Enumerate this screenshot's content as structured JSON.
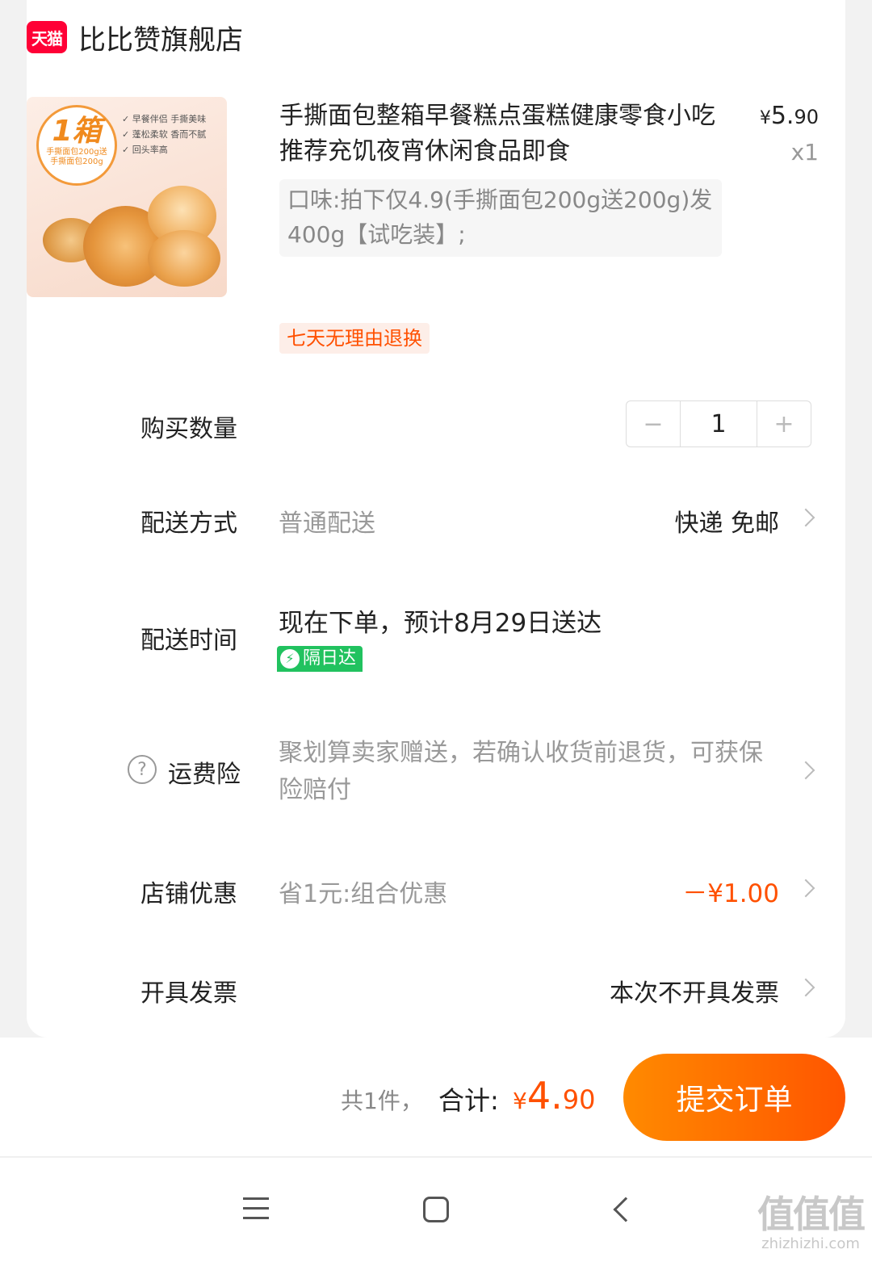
{
  "shop": {
    "logo_text": "天猫",
    "name": "比比赞旗舰店"
  },
  "product": {
    "image_badge_big": "1箱",
    "image_badge_small_1": "手撕面包200g送",
    "image_badge_small_2": "手撕面包200g",
    "image_notes": [
      "早餐伴侣 手撕美味",
      "蓬松柔软 香而不腻",
      "回头率高"
    ],
    "title": "手撕面包整箱早餐糕点蛋糕健康零食小吃推荐充饥夜宵休闲食品即食",
    "price_symbol": "¥",
    "price_int": "5.",
    "price_cents": "90",
    "quantity": "x1",
    "spec": "口味:拍下仅4.9(手撕面包200g送200g)发400g【试吃装】;",
    "return_tag": "七天无理由退换"
  },
  "quantity_row": {
    "label": "购买数量",
    "minus": "−",
    "value": "1",
    "plus": "+"
  },
  "delivery_method": {
    "label": "配送方式",
    "value": "普通配送",
    "right": "快递 免邮"
  },
  "delivery_time": {
    "label": "配送时间",
    "eta": "现在下单，预计8月29日送达",
    "tag_icon": "⚡",
    "tag": "隔日达"
  },
  "shipping_insurance": {
    "label": "运费险",
    "help_icon": "?",
    "text": "聚划算卖家赠送，若确认收货前退货，可获保险赔付"
  },
  "shop_discount": {
    "label": "店铺优惠",
    "value": "省1元:组合优惠",
    "amount": "－¥1.00"
  },
  "invoice": {
    "label": "开具发票",
    "right": "本次不开具发票"
  },
  "summary": {
    "count": "共1件，",
    "total_label": "合计:",
    "total_symbol": "¥",
    "total_int": "4.",
    "total_cents": "90",
    "submit": "提交订单"
  },
  "watermark": {
    "big": "值值值",
    "small": "zhizhizhi.com"
  },
  "colors": {
    "accent": "#ff5000",
    "tmall_red": "#ff0036",
    "next_day_green": "#21c25f"
  }
}
